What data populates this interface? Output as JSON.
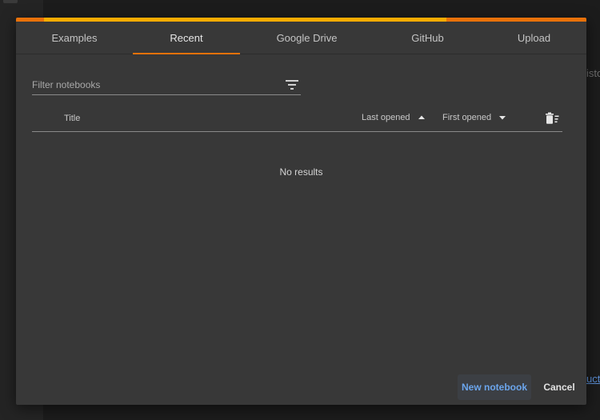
{
  "background": {
    "right_text": "isto",
    "right_link": "uct"
  },
  "colors": {
    "accent_orange": "#e8710a",
    "accent_yellow": "#f9ab00",
    "link_blue": "#6ba5ec",
    "dialog_bg": "#383838"
  },
  "tabs": [
    {
      "label": "Examples",
      "active": false
    },
    {
      "label": "Recent",
      "active": true
    },
    {
      "label": "Google Drive",
      "active": false
    },
    {
      "label": "GitHub",
      "active": false
    },
    {
      "label": "Upload",
      "active": false
    }
  ],
  "filter": {
    "placeholder": "Filter notebooks",
    "value": "",
    "icon": "filter-list-icon"
  },
  "table": {
    "title_header": "Title",
    "sort_last_opened": "Last opened",
    "sort_last_opened_direction": "ascending",
    "sort_first_opened": "First opened",
    "sort_first_opened_direction": "descending",
    "trash_icon": "delete-sweep-icon",
    "empty_message": "No results"
  },
  "footer": {
    "new_notebook": "New notebook",
    "cancel": "Cancel"
  }
}
